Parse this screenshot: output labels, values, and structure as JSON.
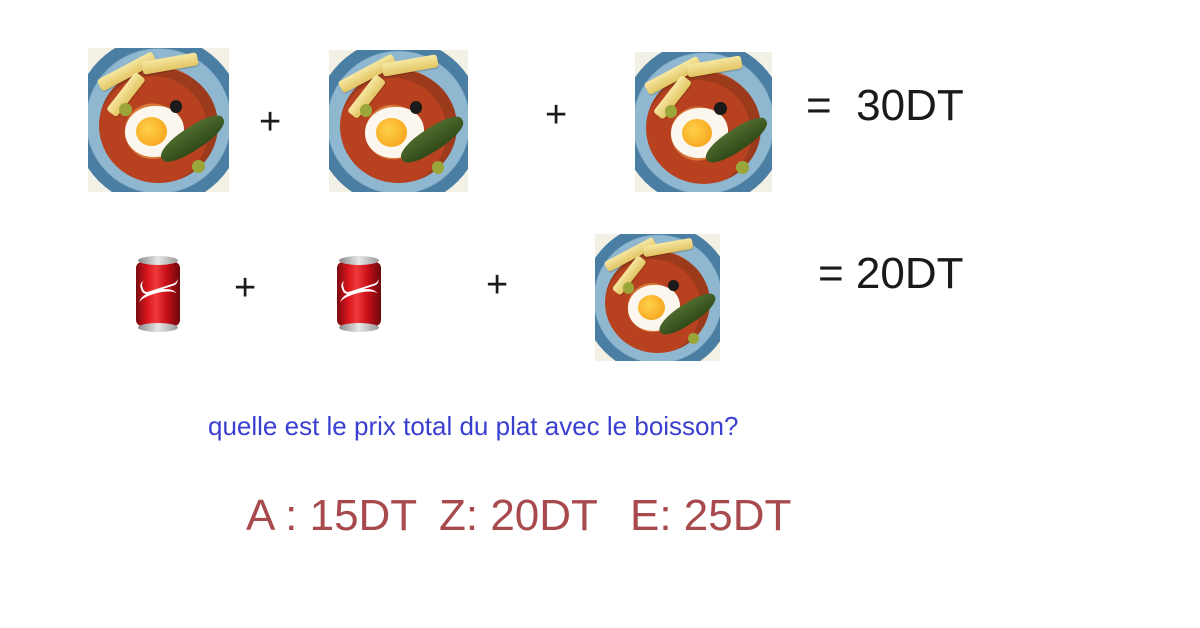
{
  "equations": [
    {
      "items": [
        "dish",
        "dish",
        "dish"
      ],
      "operators": [
        "+",
        "+"
      ],
      "result": "=  30DT"
    },
    {
      "items": [
        "soda-can",
        "soda-can",
        "dish"
      ],
      "operators": [
        "+",
        "+"
      ],
      "result": "= 20DT"
    }
  ],
  "question": "quelle est le prix total du plat avec le boisson?",
  "answers": [
    {
      "label": "A : 15DT"
    },
    {
      "label": "Z: 20DT"
    },
    {
      "label": "E: 25DT"
    }
  ],
  "colors": {
    "question": "#3a3fcf",
    "answers": "#a84a4d",
    "text": "#1a1a1a"
  }
}
